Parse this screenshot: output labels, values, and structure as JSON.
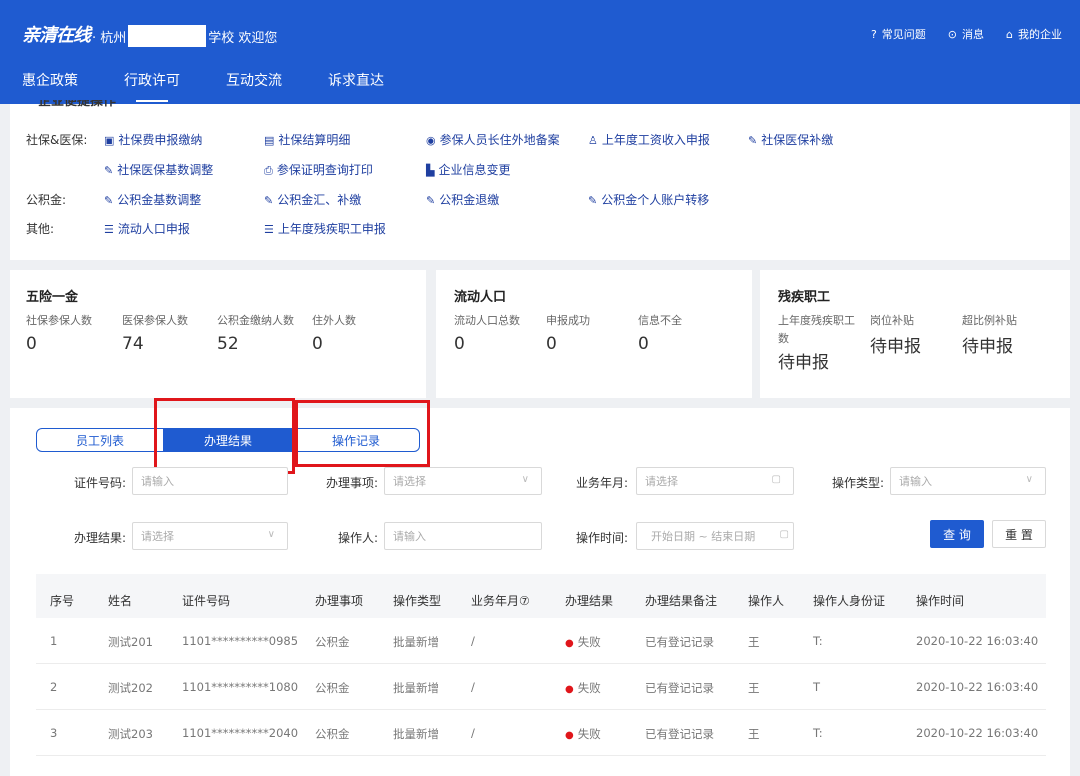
{
  "header": {
    "logo": "亲清在线",
    "welcome_prefix": "· 杭州",
    "welcome_suffix": "学校 欢迎您",
    "links": [
      {
        "icon": "?",
        "label": "常见问题"
      },
      {
        "icon": "⊙",
        "label": "消息"
      },
      {
        "icon": "⌂",
        "label": "我的企业"
      }
    ]
  },
  "nav": [
    "惠企政策",
    "行政许可",
    "互动交流",
    "诉求直达"
  ],
  "quick": {
    "title": "企业便捷操作",
    "labels": [
      "社保&医保:",
      "公积金:",
      "其他:"
    ],
    "ops": [
      {
        "icon": "▣",
        "label": "社保费申报缴纳"
      },
      {
        "icon": "▤",
        "label": "社保结算明细"
      },
      {
        "icon": "◉",
        "label": "参保人员长住外地备案"
      },
      {
        "icon": "♙",
        "label": "上年度工资收入申报"
      },
      {
        "icon": "✎",
        "label": "社保医保补缴"
      },
      {
        "icon": "✎",
        "label": "社保医保基数调整"
      },
      {
        "icon": "⎙",
        "label": "参保证明查询打印"
      },
      {
        "icon": "▙",
        "label": "企业信息变更"
      },
      {
        "icon": "✎",
        "label": "公积金基数调整"
      },
      {
        "icon": "✎",
        "label": "公积金汇、补缴"
      },
      {
        "icon": "✎",
        "label": "公积金退缴"
      },
      {
        "icon": "✎",
        "label": "公积金个人账户转移"
      },
      {
        "icon": "☰",
        "label": "流动人口申报"
      },
      {
        "icon": "☰",
        "label": "上年度残疾职工申报"
      }
    ]
  },
  "stats": {
    "insurance": {
      "title": "五险一金",
      "items": [
        {
          "label": "社保参保人数",
          "value": "0"
        },
        {
          "label": "医保参保人数",
          "value": "74"
        },
        {
          "label": "公积金缴纳人数",
          "value": "52"
        },
        {
          "label": "住外人数",
          "value": "0"
        }
      ]
    },
    "floating": {
      "title": "流动人口",
      "items": [
        {
          "label": "流动人口总数",
          "value": "0"
        },
        {
          "label": "申报成功",
          "value": "0"
        },
        {
          "label": "信息不全",
          "value": "0"
        }
      ]
    },
    "disabled": {
      "title": "残疾职工",
      "items": [
        {
          "label": "上年度残疾职工",
          "label2": "数",
          "value": "待申报"
        },
        {
          "label": "岗位补贴",
          "value": "待申报"
        },
        {
          "label": "超比例补贴",
          "value": "待申报"
        }
      ]
    }
  },
  "segments": [
    "员工列表",
    "办理结果",
    "操作记录"
  ],
  "filters": {
    "id_label": "证件号码:",
    "id_placeholder": "请输入",
    "item_label": "办理事项:",
    "item_placeholder": "请选择",
    "month_label": "业务年月:",
    "month_placeholder": "请选择",
    "optype_label": "操作类型:",
    "optype_placeholder": "请输入",
    "result_label": "办理结果:",
    "result_placeholder": "请选择",
    "operator_label": "操作人:",
    "operator_placeholder": "请输入",
    "time_label": "操作时间:",
    "time_placeholder": "开始日期 ~ 结束日期",
    "query": "查 询",
    "reset": "重 置"
  },
  "table": {
    "columns": [
      "序号",
      "姓名",
      "证件号码",
      "办理事项",
      "操作类型",
      "业务年月⑦",
      "办理结果",
      "办理结果备注",
      "操作人",
      "操作人身份证",
      "操作时间"
    ],
    "rows": [
      [
        "1",
        "测试201",
        "1101**********0985",
        "公积金",
        "批量新增",
        "/",
        "失败",
        "已有登记记录",
        "王",
        "T:",
        "2020-10-22 16:03:40"
      ],
      [
        "2",
        "测试202",
        "1101**********1080",
        "公积金",
        "批量新增",
        "/",
        "失败",
        "已有登记记录",
        "王",
        "T",
        "2020-10-22 16:03:40"
      ],
      [
        "3",
        "测试203",
        "1101**********2040",
        "公积金",
        "批量新增",
        "/",
        "失败",
        "已有登记记录",
        "王",
        "T:",
        "2020-10-22 16:03:40"
      ]
    ]
  },
  "colors": {
    "primary": "#1f5bd0",
    "highlight": "#e0161b"
  }
}
